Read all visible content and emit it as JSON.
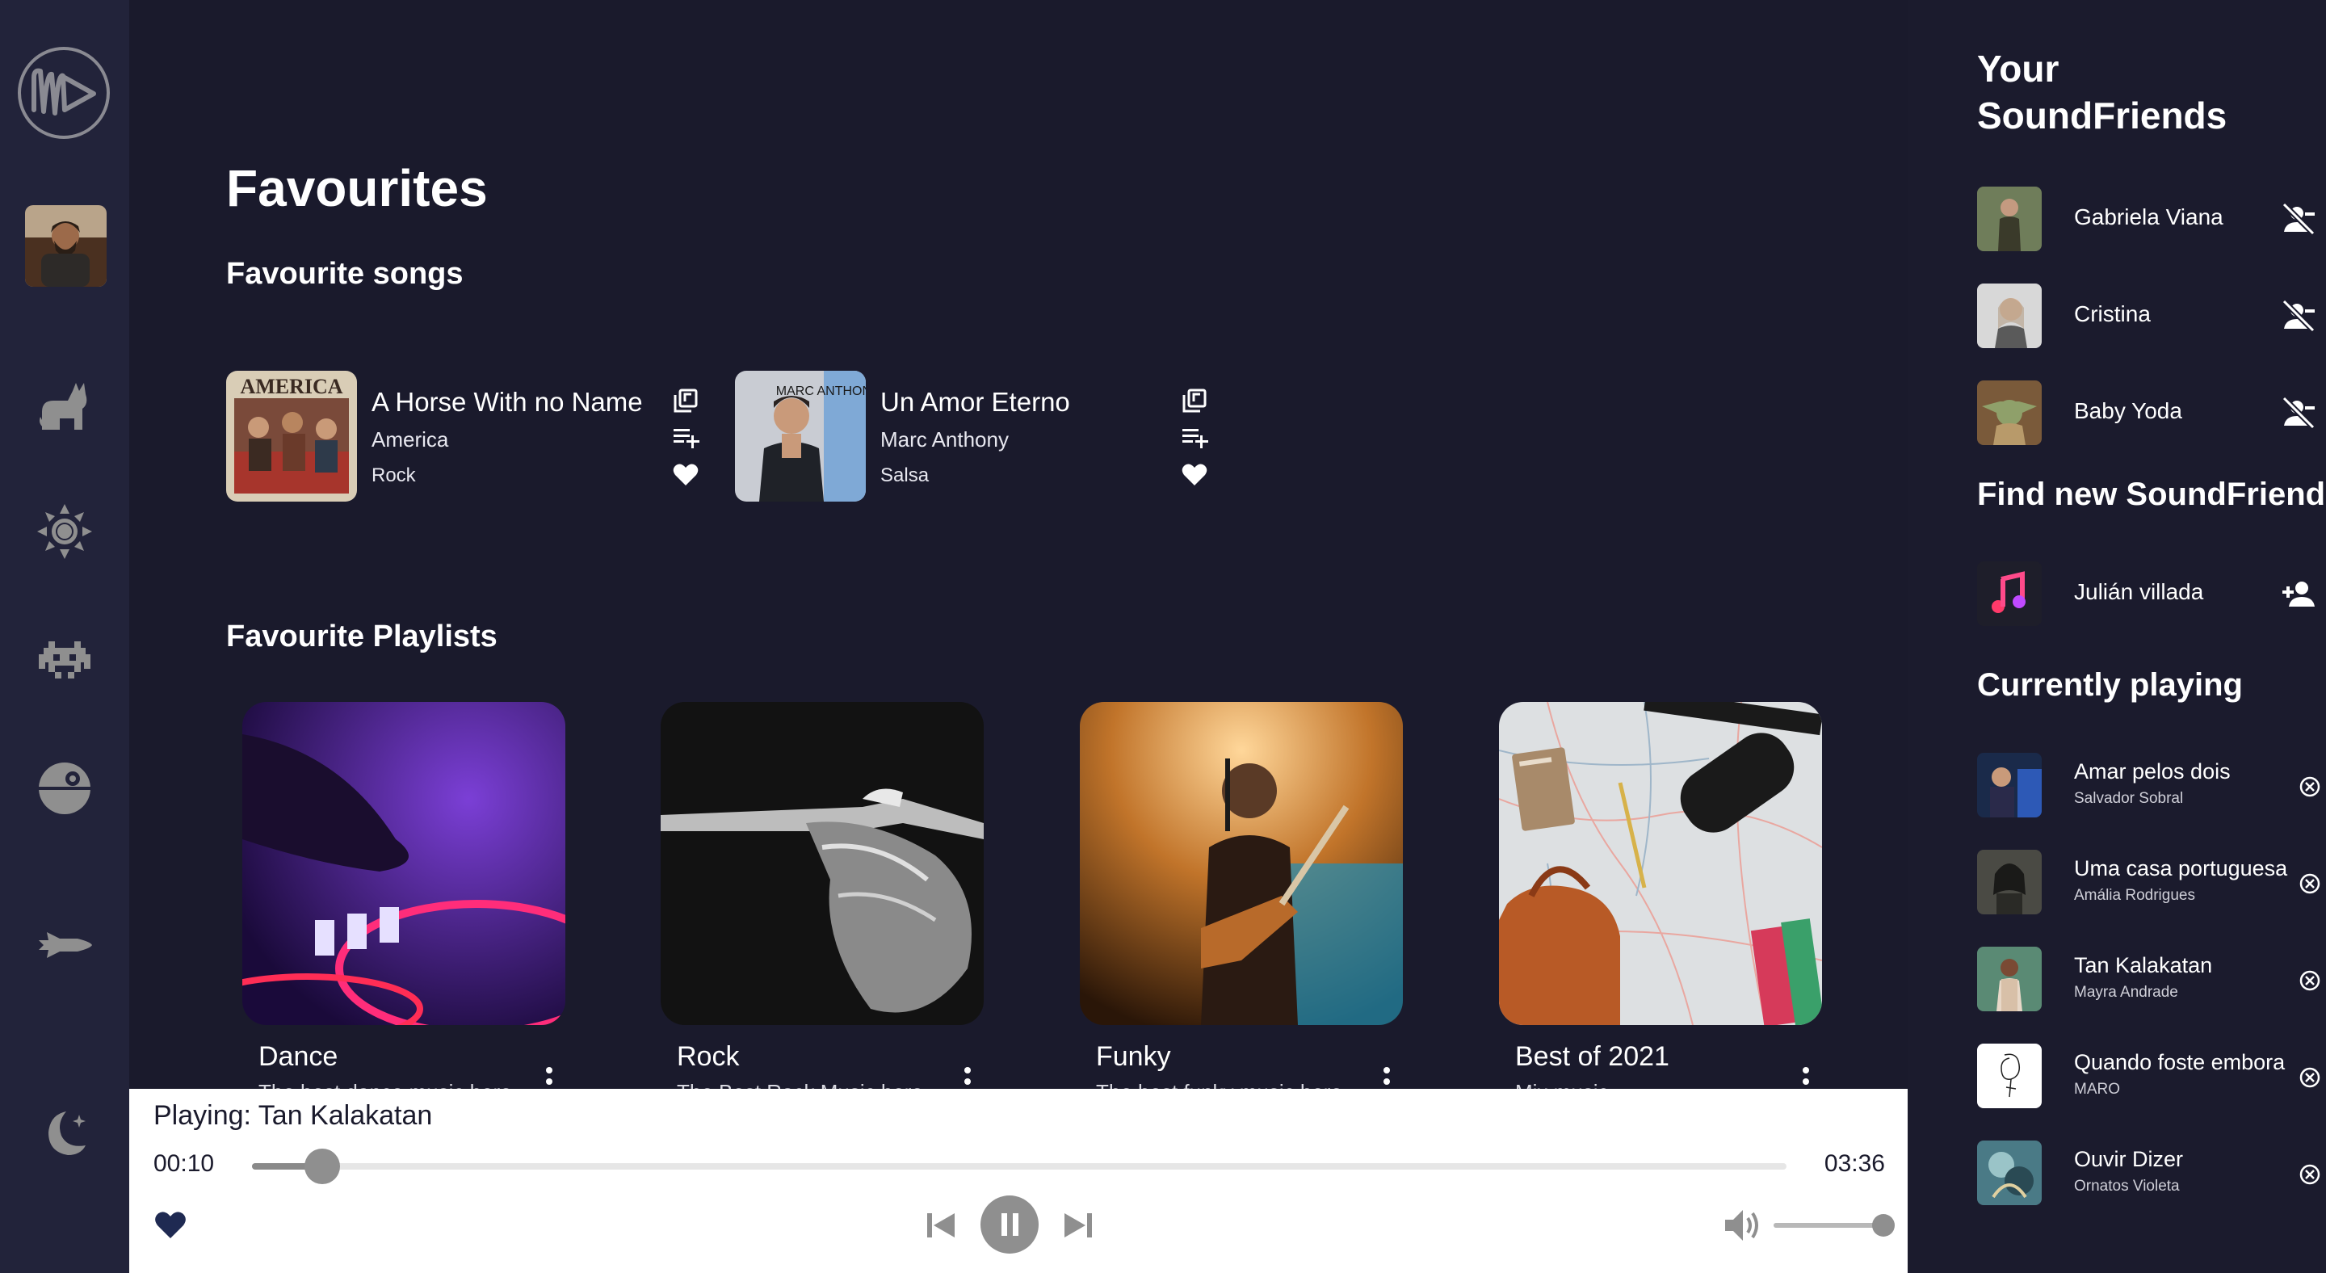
{
  "main": {
    "page_title": "Favourites",
    "songs_heading": "Favourite songs",
    "playlists_heading": "Favourite Playlists",
    "songs": [
      {
        "title": "A Horse With no Name",
        "artist": "America",
        "genre": "Rock",
        "cover_text": "AMERICA"
      },
      {
        "title": "Un Amor Eterno",
        "artist": "Marc Anthony",
        "genre": "Salsa",
        "cover_text": "MARC ANTHONY OPUS"
      }
    ],
    "playlists": [
      {
        "name": "Dance",
        "desc": "The best dance music here"
      },
      {
        "name": "Rock",
        "desc": "The Best Rock Music here"
      },
      {
        "name": "Funky",
        "desc": "The best funky music here"
      },
      {
        "name": "Best of 2021",
        "desc": "Mix music"
      }
    ]
  },
  "player": {
    "now_playing": "Playing: Tan Kalakatan",
    "current_time": "00:10",
    "total_time": "03:36",
    "progress_fraction": 0.046,
    "volume_fraction": 1.0
  },
  "right": {
    "title_line1": "Your",
    "title_line2": "SoundFriends",
    "friends": [
      {
        "name": "Gabriela Viana"
      },
      {
        "name": "Cristina"
      },
      {
        "name": "Baby Yoda"
      }
    ],
    "find_heading": "Find new SoundFriends",
    "suggestions": [
      {
        "name": "Julián villada"
      }
    ],
    "currently_heading": "Currently playing",
    "currently_playing": [
      {
        "title": "Amar pelos dois",
        "artist": "Salvador Sobral"
      },
      {
        "title": "Uma casa portuguesa",
        "artist": "Amália Rodrigues"
      },
      {
        "title": "Tan Kalakatan",
        "artist": "Mayra Andrade"
      },
      {
        "title": "Quando foste embora",
        "artist": "MARO"
      },
      {
        "title": "Ouvir Dizer",
        "artist": "Ornatos Violeta"
      }
    ]
  },
  "icons": {
    "sidebar": [
      "app-logo-icon",
      "cat-icon",
      "sun-icon",
      "space-invader-icon",
      "death-star-icon",
      "spaceship-icon",
      "moon-icon"
    ],
    "song_actions": [
      "add-to-library-icon",
      "add-to-queue-icon",
      "heart-icon"
    ],
    "friends": [
      "remove-friend-icon",
      "add-friend-icon",
      "remove-circle-icon"
    ]
  },
  "colors": {
    "background": "#1a1a2c",
    "sidebar": "#22233a",
    "player_bg": "#ffffff",
    "player_accent": "#1f2a52",
    "icon_gray": "#8f8f8f"
  }
}
